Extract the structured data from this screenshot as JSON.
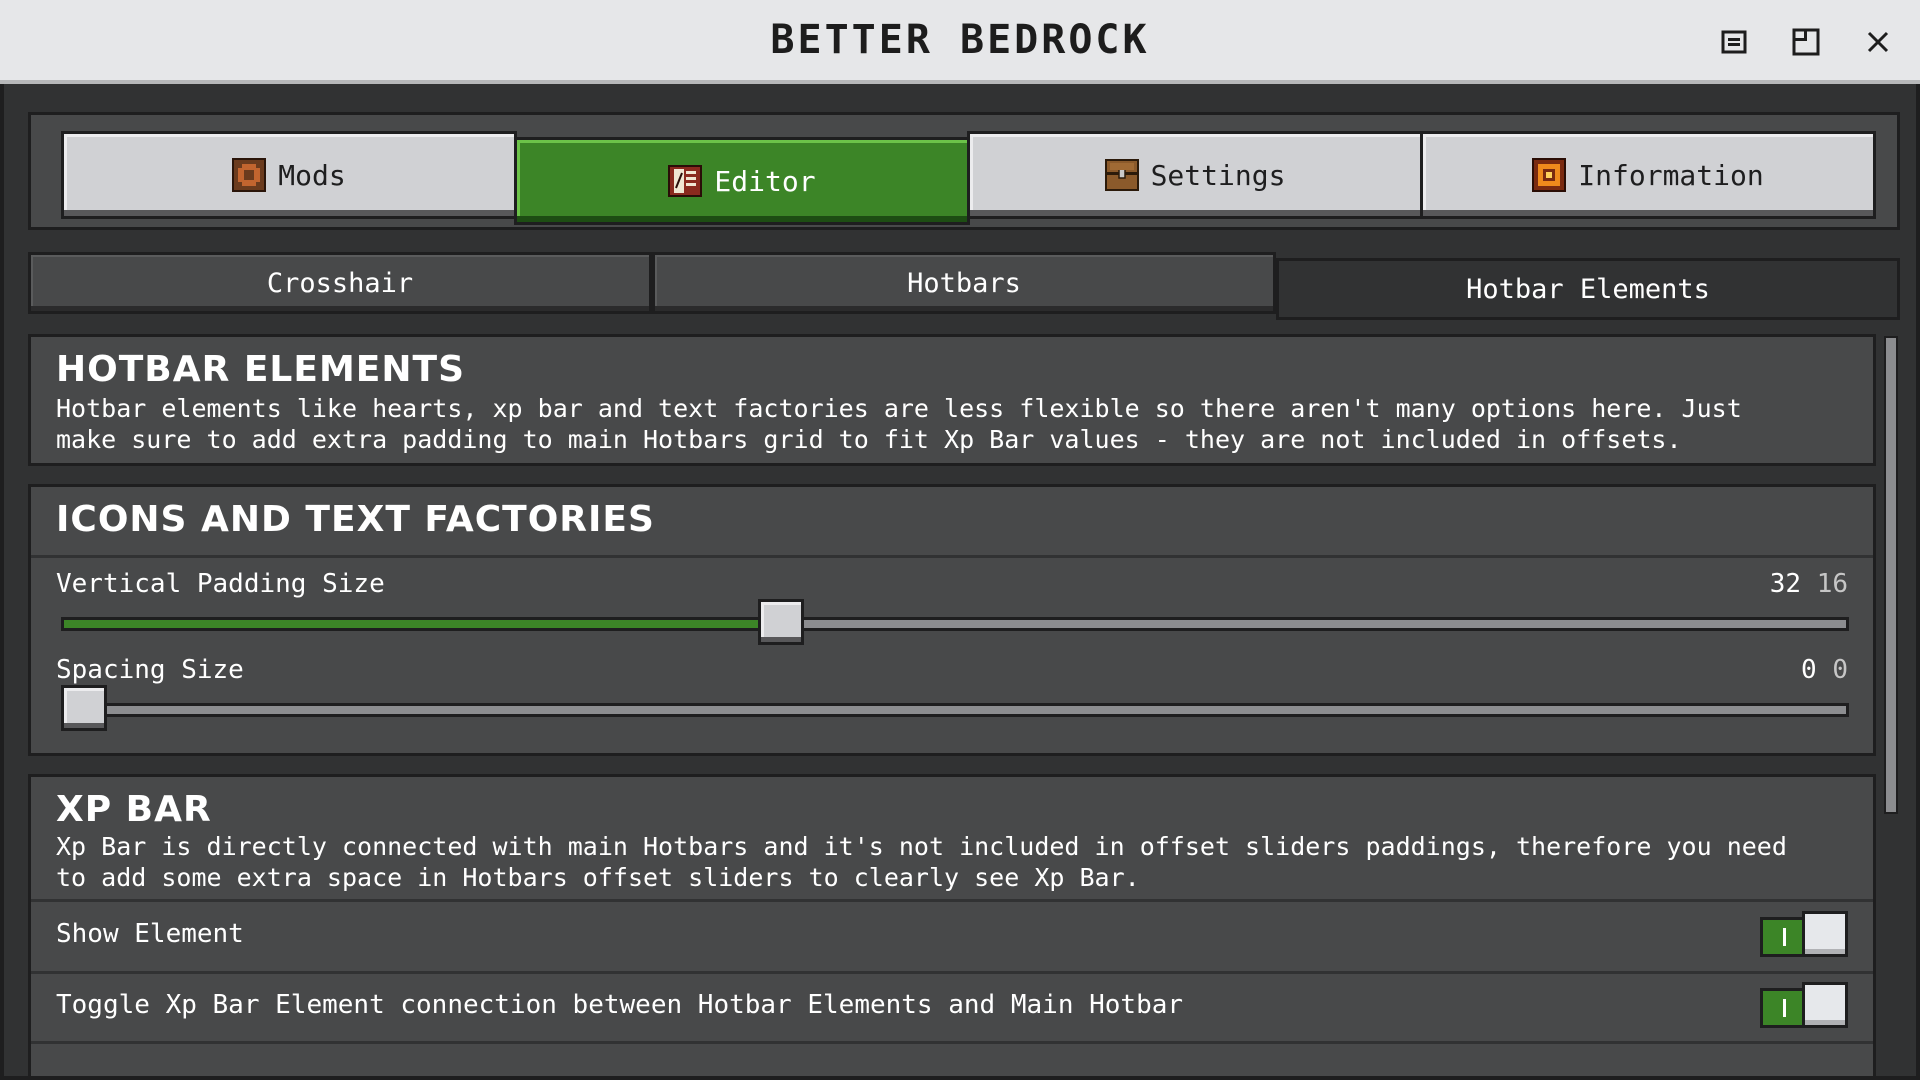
{
  "window": {
    "title": "BETTER BEDROCK",
    "controls": [
      "minimize-icon",
      "restore-icon",
      "close-icon"
    ]
  },
  "main_tabs": [
    {
      "label": "Mods",
      "icon": "mods-icon",
      "active": false
    },
    {
      "label": "Editor",
      "icon": "editor-book-icon",
      "active": true
    },
    {
      "label": "Settings",
      "icon": "settings-chest-icon",
      "active": false
    },
    {
      "label": "Information",
      "icon": "information-icon",
      "active": false
    }
  ],
  "sub_tabs": [
    {
      "label": "Crosshair",
      "active": false
    },
    {
      "label": "Hotbars",
      "active": false
    },
    {
      "label": "Hotbar Elements",
      "active": true
    }
  ],
  "sections": {
    "hotbar_elements": {
      "title": "HOTBAR ELEMENTS",
      "desc_line1": "Hotbar elements like hearts, xp bar and text factories are less flexible so there aren't many options here. Just",
      "desc_line2": "make sure to add extra padding to main Hotbars grid to fit Xp Bar values - they are not included in offsets."
    },
    "icons_text": {
      "title": "ICONS AND TEXT FACTORIES",
      "vertical_padding": {
        "label": "Vertical Padding Size",
        "value": "32",
        "default": "16",
        "fraction": 0.4
      },
      "spacing": {
        "label": "Spacing Size",
        "value": "0",
        "default": "0",
        "fraction": 0.0
      }
    },
    "xp_bar": {
      "title": "XP BAR",
      "desc_line1": "Xp Bar is directly connected with main Hotbars and it's not included in offset sliders paddings, therefore you need",
      "desc_line2": "to add some extra space in Hotbars offset sliders to clearly see Xp Bar.",
      "show_element": {
        "label": "Show Element",
        "on": true
      },
      "toggle_connection": {
        "label": "Toggle Xp Bar Element connection between Hotbar Elements and Main Hotbar",
        "on": true
      }
    }
  },
  "colors": {
    "accent_green": "#3c8527",
    "panel": "#48494a",
    "background": "#313233",
    "button": "#d0d1d4"
  }
}
